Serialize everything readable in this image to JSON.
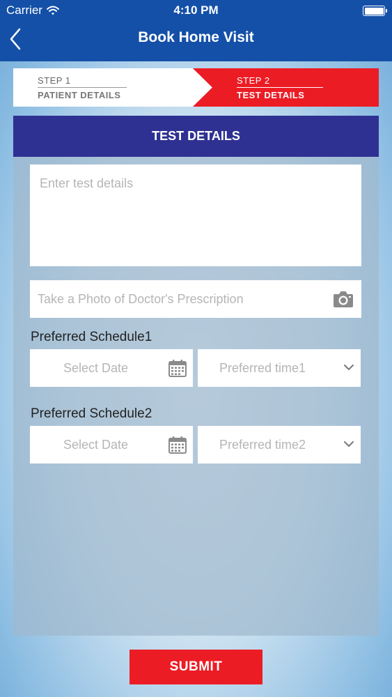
{
  "status_bar": {
    "carrier": "Carrier",
    "time": "4:10 PM"
  },
  "header": {
    "title": "Book Home Visit"
  },
  "stepper": {
    "steps": [
      {
        "number": "STEP 1",
        "name": "PATIENT DETAILS",
        "active": false
      },
      {
        "number": "STEP 2",
        "name": "TEST DETAILS",
        "active": true
      }
    ]
  },
  "panel": {
    "title": "TEST DETAILS",
    "test_details_placeholder": "Enter test details",
    "photo_placeholder": "Take a Photo of Doctor's Prescription",
    "schedules": [
      {
        "label": "Preferred Schedule1",
        "date_placeholder": "Select Date",
        "time_placeholder": "Preferred time1"
      },
      {
        "label": "Preferred Schedule2",
        "date_placeholder": "Select Date",
        "time_placeholder": "Preferred time2"
      }
    ]
  },
  "submit_label": "SUBMIT",
  "colors": {
    "header_blue": "#1450a8",
    "panel_header_navy": "#2e3192",
    "accent_red": "#ec1c24",
    "placeholder_gray": "#b5b5b5"
  },
  "icons": [
    "wifi-icon",
    "battery-icon",
    "back-chevron-icon",
    "camera-icon",
    "calendar-icon",
    "chevron-down-icon"
  ]
}
